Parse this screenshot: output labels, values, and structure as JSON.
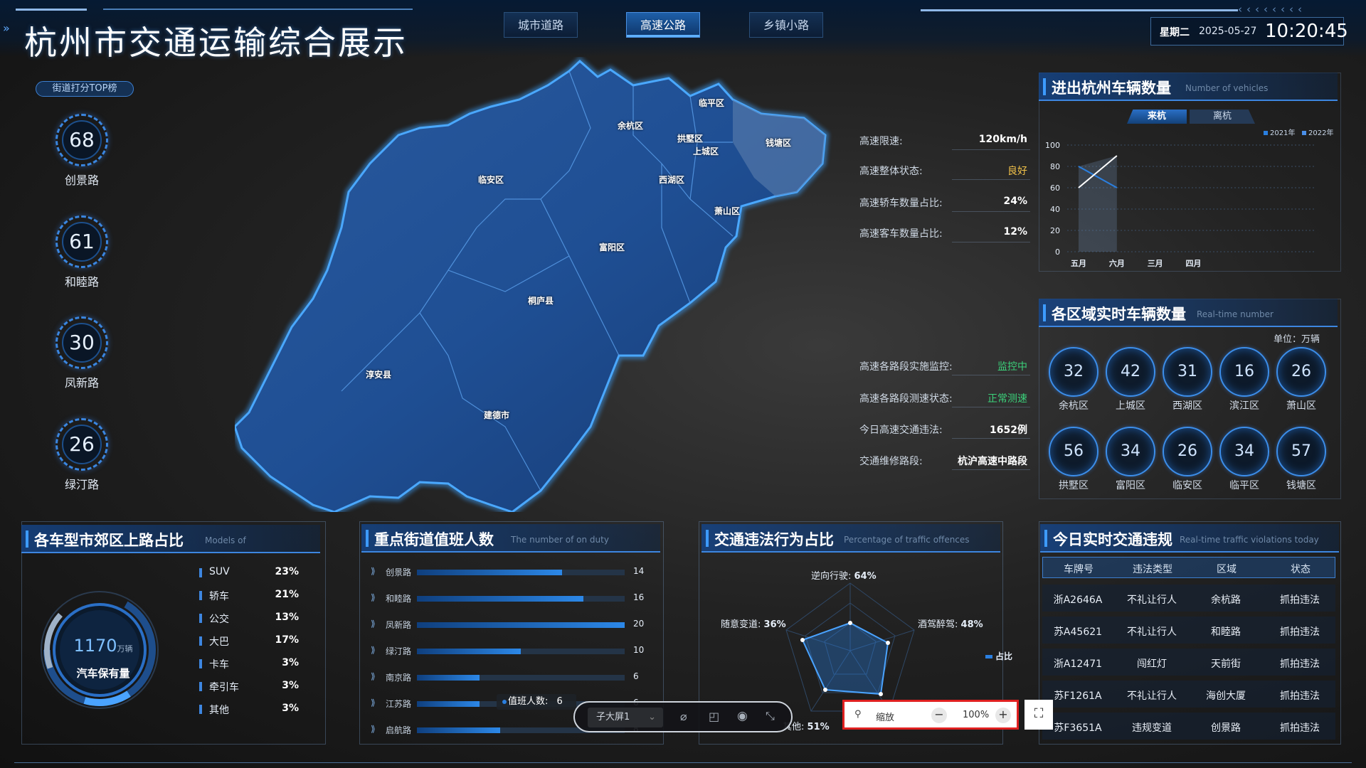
{
  "header": {
    "title": "杭州市交通运输综合展示",
    "tabs": [
      {
        "label": "城市道路",
        "active": false
      },
      {
        "label": "高速公路",
        "active": true
      },
      {
        "label": "乡镇小路",
        "active": false
      }
    ],
    "weekday": "星期二",
    "date": "2025-05-27",
    "time": "10:20:45"
  },
  "street_rank": {
    "button": "街道打分TOP榜",
    "items": [
      {
        "score": "68",
        "name": "创景路"
      },
      {
        "score": "61",
        "name": "和睦路"
      },
      {
        "score": "30",
        "name": "凤新路"
      },
      {
        "score": "26",
        "name": "绿汀路"
      }
    ]
  },
  "map": {
    "districts": [
      "临平区",
      "余杭区",
      "拱墅区",
      "上城区",
      "钱塘区",
      "临安区",
      "西湖区",
      "萧山区",
      "富阳区",
      "桐庐县",
      "淳安县",
      "建德市"
    ]
  },
  "highway_info": {
    "rows1": [
      {
        "label": "高速限速:",
        "value": "120km/h",
        "style": "bold"
      },
      {
        "label": "高速整体状态:",
        "value": "良好",
        "style": "yellow"
      },
      {
        "label": "高速轿车数量占比:",
        "value": "24%",
        "style": "bold"
      },
      {
        "label": "高速客车数量占比:",
        "value": "12%",
        "style": "bold"
      }
    ],
    "rows2": [
      {
        "label": "高速各路段实施监控:",
        "value": "监控中",
        "style": "green"
      },
      {
        "label": "高速各路段测速状态:",
        "value": "正常测速",
        "style": "green"
      },
      {
        "label": "今日高速交通违法:",
        "value": "1652例",
        "style": "bold"
      },
      {
        "label": "交通维修路段:",
        "value": "杭沪高速中路段",
        "style": "bold"
      }
    ]
  },
  "vehicles_panel": {
    "title": "进出杭州车辆数量",
    "subtitle": "Number of vehicles",
    "tab_in": "来杭",
    "tab_out": "离杭",
    "legend": [
      "2021年",
      "2022年"
    ],
    "colors": {
      "y2021": "#2a7fe0",
      "y2022": "#ffffff"
    }
  },
  "chart_data": {
    "type": "line",
    "categories": [
      "五月",
      "六月",
      "三月",
      "四月"
    ],
    "ylim": [
      0,
      100
    ],
    "yticks": [
      0,
      20,
      40,
      60,
      80,
      100
    ],
    "series": [
      {
        "name": "2021年",
        "values": [
          80,
          60,
          null,
          null
        ]
      },
      {
        "name": "2022年",
        "values": [
          60,
          90,
          null,
          null
        ]
      }
    ],
    "grid": true,
    "legend_position": "top-right"
  },
  "area_panel": {
    "title": "各区域实时车辆数量",
    "subtitle": "Real-time number",
    "unit": "单位：万辆",
    "areas": [
      {
        "value": "32",
        "name": "余杭区"
      },
      {
        "value": "42",
        "name": "上城区"
      },
      {
        "value": "31",
        "name": "西湖区"
      },
      {
        "value": "16",
        "name": "滨江区"
      },
      {
        "value": "26",
        "name": "萧山区"
      },
      {
        "value": "56",
        "name": "拱墅区"
      },
      {
        "value": "34",
        "name": "富阳区"
      },
      {
        "value": "26",
        "name": "临安区"
      },
      {
        "value": "34",
        "name": "临平区"
      },
      {
        "value": "57",
        "name": "钱塘区"
      }
    ]
  },
  "models_panel": {
    "title": "各车型市郊区上路占比",
    "subtitle": "Models of",
    "total": "1170",
    "total_unit": "万辆",
    "total_label": "汽车保有量",
    "rows": [
      {
        "name": "SUV",
        "pct": "23%"
      },
      {
        "name": "轿车",
        "pct": "21%"
      },
      {
        "name": "公交",
        "pct": "13%"
      },
      {
        "name": "大巴",
        "pct": "17%"
      },
      {
        "name": "卡车",
        "pct": "3%"
      },
      {
        "name": "牵引车",
        "pct": "3%"
      },
      {
        "name": "其他",
        "pct": "3%"
      }
    ]
  },
  "duty_panel": {
    "title": "重点街道值班人数",
    "subtitle": "The number of on duty",
    "max": 20,
    "rows": [
      {
        "name": "创景路",
        "value": 14
      },
      {
        "name": "和睦路",
        "value": 16
      },
      {
        "name": "凤新路",
        "value": 20
      },
      {
        "name": "绿汀路",
        "value": 10
      },
      {
        "name": "南京路",
        "value": 6
      },
      {
        "name": "江苏路",
        "value": 6
      },
      {
        "name": "启航路",
        "value": 8
      }
    ],
    "tooltip_label": "值班人数:",
    "tooltip_value": "6"
  },
  "offence_panel": {
    "title": "交通违法行为占比",
    "subtitle": "Percentage of traffic offences",
    "labels": [
      {
        "name": "逆向行驶:",
        "pct": "64%"
      },
      {
        "name": "随意变道:",
        "pct": "36%"
      },
      {
        "name": "酒驾醉驾:",
        "pct": "48%"
      },
      {
        "name": "其他:",
        "pct": "51%"
      }
    ],
    "legend": "占比"
  },
  "violations_panel": {
    "title": "今日实时交通违规",
    "subtitle": "Real-time traffic violations today",
    "headers": [
      "车牌号",
      "违法类型",
      "区域",
      "状态"
    ],
    "rows": [
      [
        "浙A2646A",
        "不礼让行人",
        "余杭路",
        "抓拍违法"
      ],
      [
        "苏A45621",
        "不礼让行人",
        "和睦路",
        "抓拍违法"
      ],
      [
        "浙A12471",
        "闯红灯",
        "天前街",
        "抓拍违法"
      ],
      [
        "苏F1261A",
        "不礼让行人",
        "海创大厦",
        "抓拍违法"
      ],
      [
        "苏F3651A",
        "违规变道",
        "创景路",
        "抓拍违法"
      ]
    ]
  },
  "toolbar": {
    "screen_select": "子大屏1",
    "zoom_label": "缩放",
    "zoom_value": "100%",
    "minus": "−",
    "plus": "+"
  }
}
